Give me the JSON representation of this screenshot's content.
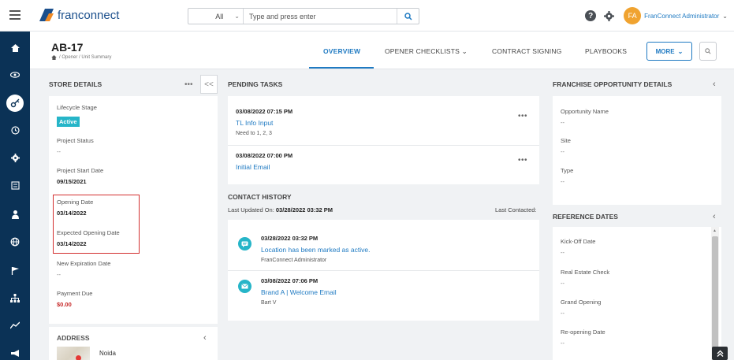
{
  "app": {
    "logo_text": "franconnect"
  },
  "search": {
    "scope": "All",
    "placeholder": "Type and press enter"
  },
  "user": {
    "initials": "FA",
    "name": "FranConnect Administrator"
  },
  "page": {
    "title": "AB-17",
    "breadcrumb": "/ Opener / Unit Summary",
    "tabs": [
      {
        "label": "OVERVIEW",
        "active": true
      },
      {
        "label": "OPENER CHECKLISTS",
        "has_dropdown": true
      },
      {
        "label": "CONTRACT SIGNING"
      },
      {
        "label": "PLAYBOOKS"
      }
    ],
    "more_label": "MORE"
  },
  "store_details": {
    "title": "STORE DETAILS",
    "dots": "•••",
    "collapse": "<<",
    "fields": [
      {
        "label": "Lifecycle Stage",
        "value": "Active",
        "badge": true
      },
      {
        "label": "Project Status",
        "value": "--"
      },
      {
        "label": "Project Start Date",
        "value": "09/15/2021"
      },
      {
        "label": "Opening Date",
        "value": "03/14/2022"
      },
      {
        "label": "Expected Opening Date",
        "value": "03/14/2022"
      },
      {
        "label": "New Expiration Date",
        "value": "--"
      },
      {
        "label": "Payment Due",
        "value": "$0.00"
      }
    ]
  },
  "address": {
    "title": "ADDRESS",
    "city": "Noida"
  },
  "pending_tasks": {
    "title": "PENDING TASKS",
    "items": [
      {
        "date": "03/08/2022 07:15 PM",
        "name": "TL Info Input",
        "sub": "Need to 1, 2, 3"
      },
      {
        "date": "03/08/2022 07:00 PM",
        "name": "Initial Email",
        "sub": ""
      }
    ],
    "dots": "•••"
  },
  "contact_history": {
    "title": "CONTACT HISTORY",
    "last_updated_label": "Last Updated On:",
    "last_updated_value": "03/28/2022 03:32 PM",
    "last_contacted_label": "Last Contacted:",
    "items": [
      {
        "date": "03/28/2022 03:32 PM",
        "text": "Location has been marked as active.",
        "by": "FranConnect Administrator",
        "icon": "chat-icon"
      },
      {
        "date": "03/08/2022 07:06 PM",
        "text": "Brand A | Welcome Email",
        "by": "Bart V",
        "icon": "mail-icon"
      }
    ]
  },
  "franchise_opportunity": {
    "title": "FRANCHISE OPPORTUNITY DETAILS",
    "fields": [
      {
        "label": "Opportunity Name",
        "value": "--"
      },
      {
        "label": "Site",
        "value": "--"
      },
      {
        "label": "Type",
        "value": "--"
      }
    ]
  },
  "reference_dates": {
    "title": "REFERENCE DATES",
    "fields": [
      {
        "label": "Kick-Off Date",
        "value": "--"
      },
      {
        "label": "Real Estate Check",
        "value": "--"
      },
      {
        "label": "Grand Opening",
        "value": "--"
      },
      {
        "label": "Re-opening Date",
        "value": "--"
      }
    ]
  },
  "nav_icons": [
    "home-icon",
    "eye-icon",
    "key-icon",
    "clock-icon",
    "gear-icon",
    "list-icon",
    "user-icon",
    "globe-icon",
    "flag-icon",
    "sitemap-icon",
    "chart-icon",
    "megaphone-icon"
  ],
  "colors": {
    "accent": "#1f7ac2",
    "nav_bg": "#0b3256",
    "badge": "#26b5c8",
    "alert": "#c62828",
    "avatar": "#f0a330"
  }
}
